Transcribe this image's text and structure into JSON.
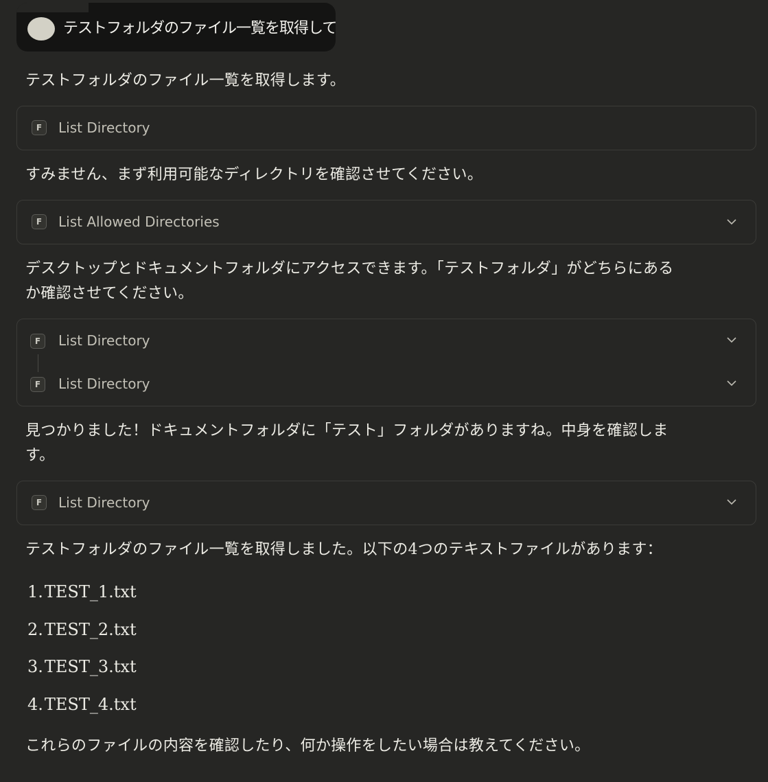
{
  "user_message": {
    "text": "テストフォルダのファイル一覧を取得して"
  },
  "messages": {
    "intro": "テストフォルダのファイル一覧を取得します。",
    "apology": "すみません、まず利用可能なディレクトリを確認させてください。",
    "access": "デスクトップとドキュメントフォルダにアクセスできます。「テストフォルダ」がどちらにある",
    "access_line2": "か確認させてください。",
    "found": "見つかりました！ドキュメントフォルダに「テスト」フォルダがありますね。中身を確認しま",
    "found_line2": "す。",
    "result": "テストフォルダのファイル一覧を取得しました。以下の4つのテキストファイルがあります：",
    "closing": "これらのファイルの内容を確認したり、何か操作をしたい場合は教えてください。"
  },
  "tools": {
    "icon_letter": "F",
    "call1": "List Directory",
    "call2": "List Allowed Directories",
    "call3a": "List Directory",
    "call3b": "List Directory",
    "call4": "List Directory"
  },
  "files": [
    {
      "num": "1.",
      "name": "TEST_1.txt"
    },
    {
      "num": "2.",
      "name": "TEST_2.txt"
    },
    {
      "num": "3.",
      "name": "TEST_3.txt"
    },
    {
      "num": "4.",
      "name": "TEST_4.txt"
    }
  ],
  "icons": {
    "tool": "filesystem-icon",
    "expand": "chevron-down-icon"
  }
}
